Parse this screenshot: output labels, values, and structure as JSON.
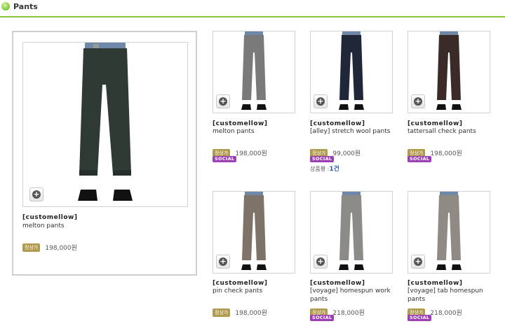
{
  "header": {
    "title": "Pants",
    "accent": "#8cc63f"
  },
  "featured": {
    "brand": "[customellow]",
    "name": "melton pants",
    "price_badge": "정상가",
    "price": "198,000원",
    "pants_color": "#2f3a35"
  },
  "products": [
    {
      "brand": "[customellow]",
      "name": "melton pants",
      "price_badge": "정상가",
      "price": "198,000원",
      "social": "SOCIAL",
      "pants_color": "#7a7a7a"
    },
    {
      "brand": "[customellow]",
      "name": "[alley] stretch wool pants",
      "price_badge": "정상가",
      "price": "99,000원",
      "social": "SOCIAL",
      "review_label": "상품평 :",
      "review_count": "1건",
      "pants_color": "#1f2738"
    },
    {
      "brand": "[customellow]",
      "name": "tattersall check pants",
      "price_badge": "정상가",
      "price": "198,000원",
      "social": "SOCIAL",
      "pants_color": "#3b2b28"
    },
    {
      "brand": "[customellow]",
      "name": "pin check pants",
      "price_badge": "정상가",
      "price": "198,000원",
      "pants_color": "#7d7368"
    },
    {
      "brand": "[customellow]",
      "name": "[voyage] homespun work pants",
      "price_badge": "정상가",
      "price": "218,000원",
      "social": "SOCIAL",
      "pants_color": "#8d8b87"
    },
    {
      "brand": "[customellow]",
      "name": "[voyage] tab homespun pants",
      "price_badge": "정상가",
      "price": "218,000원",
      "social": "SOCIAL",
      "pants_color": "#8f8a84"
    }
  ],
  "icons": {
    "plus": "plus-circle-icon",
    "header": "green-dot-icon"
  },
  "colors": {
    "social": "#9c3fb5",
    "price_badge": "#b09a4e"
  }
}
